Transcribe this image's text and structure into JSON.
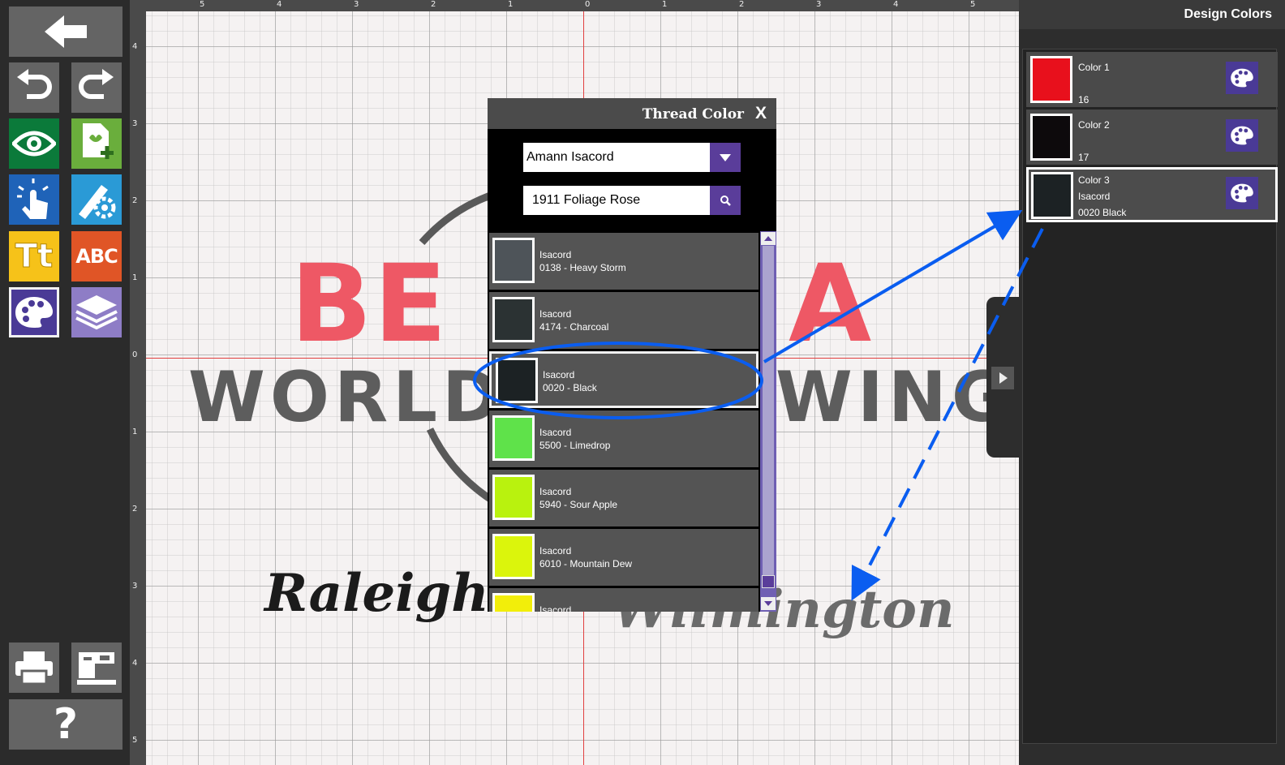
{
  "toolbar": {
    "back": "back-arrow-icon",
    "undo": "undo-icon",
    "redo": "redo-icon",
    "view": "eye-icon",
    "add_design": "add-design-icon",
    "select": "touch-select-icon",
    "edit_tools": "edit-tools-icon",
    "text": "Tt",
    "monogram": "ABC",
    "colors": "palette-icon",
    "layers": "layers-icon",
    "print": "printer-icon",
    "send": "embroidery-machine-icon",
    "help": "?"
  },
  "rulers": {
    "horizontal": [
      "5",
      "4",
      "3",
      "2",
      "1",
      "0",
      "1",
      "2",
      "3",
      "4",
      "5"
    ],
    "vertical": [
      "4",
      "3",
      "2",
      "1",
      "0",
      "1",
      "2",
      "3",
      "4",
      "5"
    ]
  },
  "canvas": {
    "top_text_left": "BE",
    "top_text_right": "A",
    "middle_text_left": "WORLD",
    "middle_text_right": "WING",
    "script_left": "Raleigh",
    "script_right": "Wilmington"
  },
  "thread_dialog": {
    "title": "Thread Color",
    "close_label": "X",
    "brand_value": "Amann Isacord",
    "search_value": "1911 Foliage Rose",
    "threads": [
      {
        "brand": "Isacord",
        "name": "0138 - Heavy Storm",
        "color": "#4e5459"
      },
      {
        "brand": "Isacord",
        "name": "4174 - Charcoal",
        "color": "#2b3233"
      },
      {
        "brand": "Isacord",
        "name": "0020 - Black",
        "color": "#1c2224",
        "selected": true
      },
      {
        "brand": "Isacord",
        "name": "5500 - Limedrop",
        "color": "#5fe24a"
      },
      {
        "brand": "Isacord",
        "name": "5940 - Sour Apple",
        "color": "#b9f20e"
      },
      {
        "brand": "Isacord",
        "name": "6010 - Mountain Dew",
        "color": "#dbf50c"
      },
      {
        "brand": "Isacord",
        "name": "",
        "color": "#f2ee0a"
      }
    ]
  },
  "design_colors": {
    "title": "Design Colors",
    "colors": [
      {
        "label": "Color 1",
        "line2": "",
        "line3": "16",
        "color": "#e8101c"
      },
      {
        "label": "Color 2",
        "line2": "",
        "line3": "17",
        "color": "#0d0a0c"
      },
      {
        "label": "Color 3",
        "line2": "Isacord",
        "line3": "0020 Black",
        "color": "#1c2224",
        "selected": true
      }
    ]
  },
  "accent_color": "#5a3d9a",
  "annotation_color": "#0a5df0"
}
